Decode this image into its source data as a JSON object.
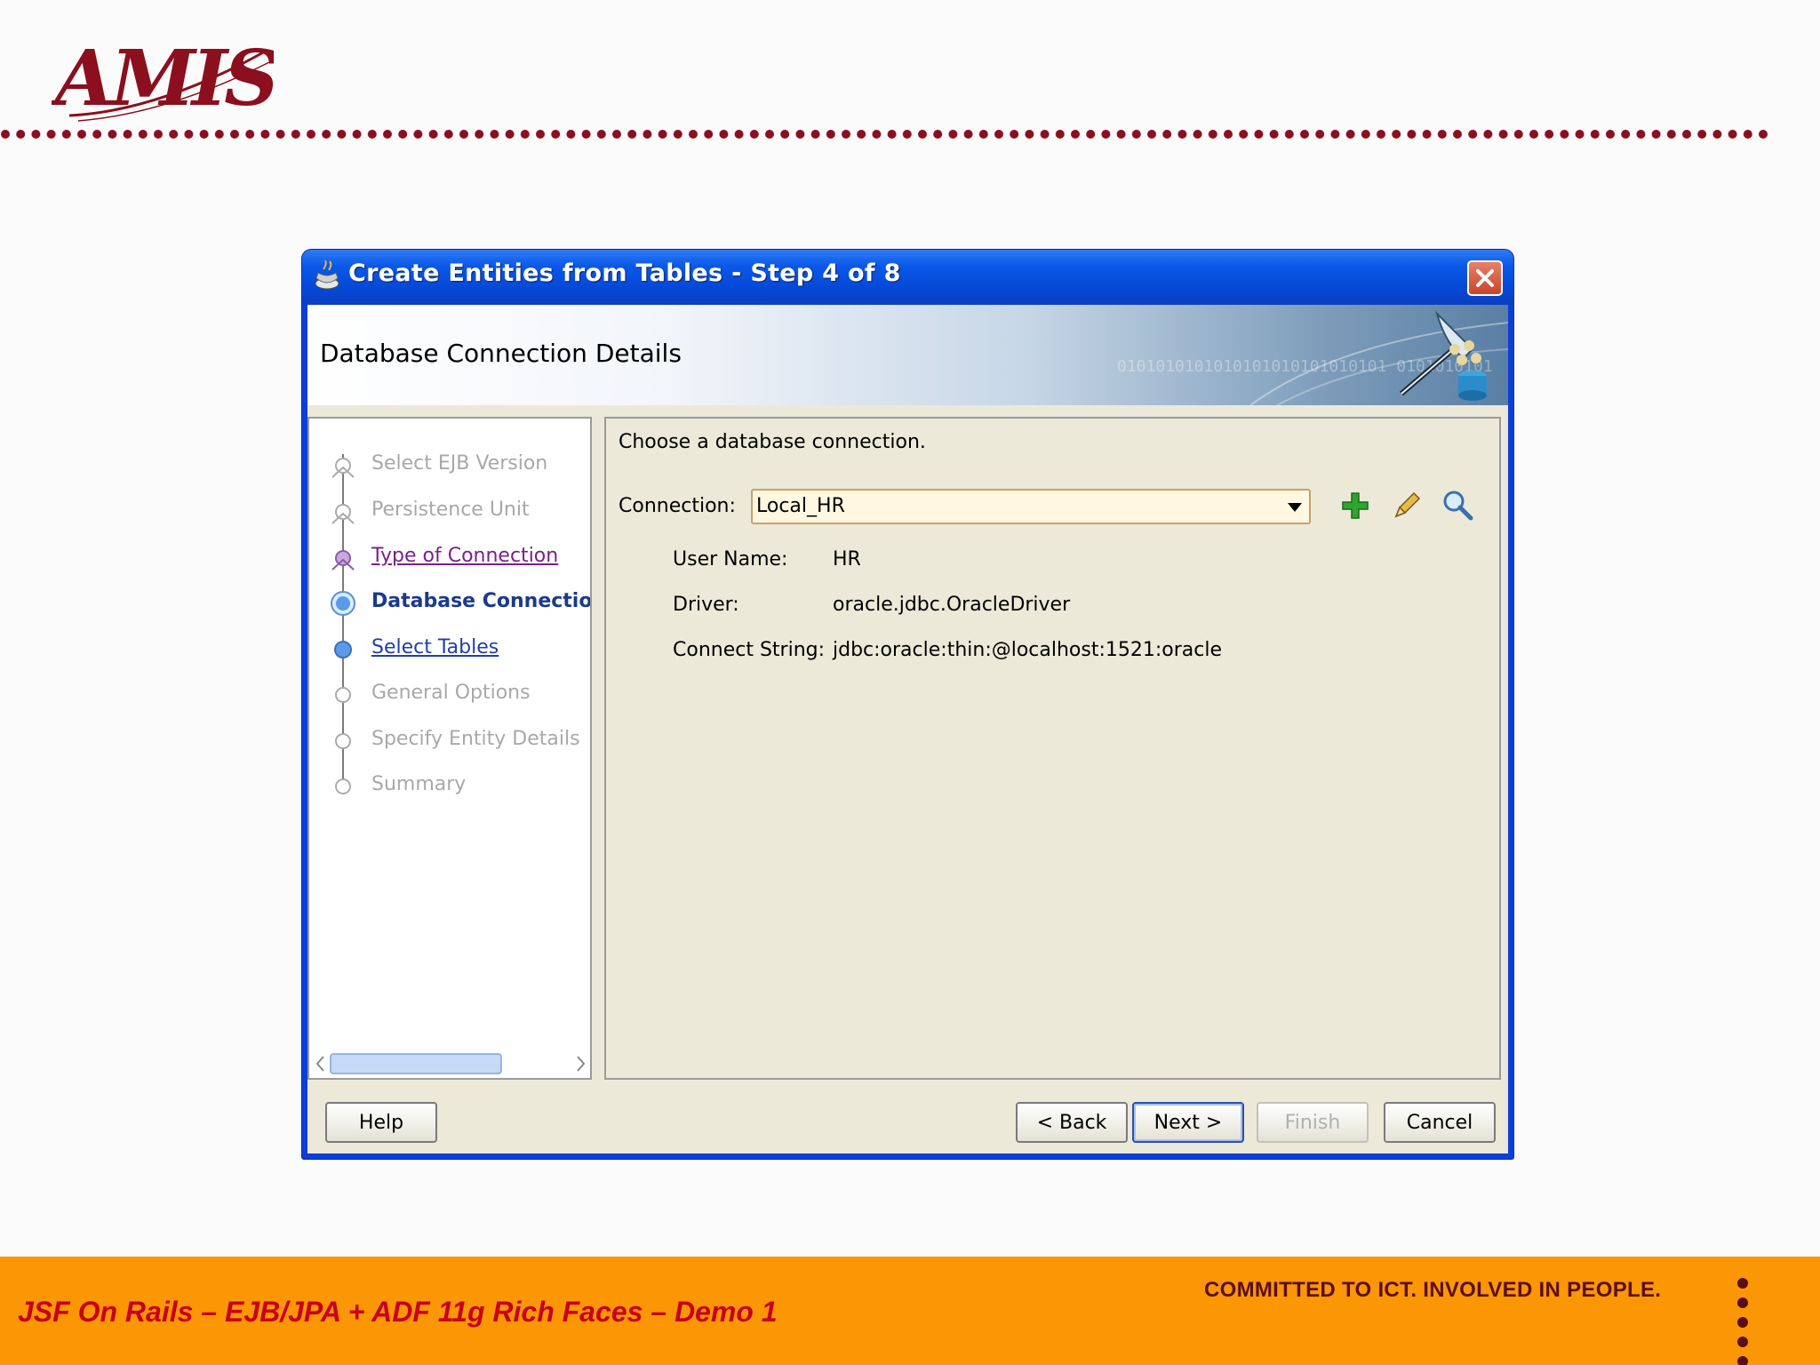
{
  "slide": {
    "logo_text": "AMIS",
    "footer_left": "JSF On Rails – EJB/JPA + ADF 11g Rich Faces – Demo 1",
    "footer_right": "COMMITTED TO ICT. INVOLVED IN PEOPLE.",
    "colors": {
      "brand": "#8b0f1e",
      "footer_bg": "#fb9604",
      "footer_text": "#c8001a"
    }
  },
  "dialog": {
    "title": "Create Entities from Tables - Step 4 of 8",
    "close_icon": "close-icon",
    "banner_title": "Database Connection Details",
    "banner_binary": "0101010101010101010101010101 0101010101",
    "nav": {
      "items": [
        {
          "label": "Select EJB Version",
          "state": "disabled"
        },
        {
          "label": "Persistence Unit",
          "state": "disabled"
        },
        {
          "label": "Type of Connection",
          "state": "visited"
        },
        {
          "label": "Database Connectio",
          "state": "current"
        },
        {
          "label": "Select Tables",
          "state": "link"
        },
        {
          "label": "General Options",
          "state": "disabled"
        },
        {
          "label": "Specify Entity Details",
          "state": "disabled"
        },
        {
          "label": "Summary",
          "state": "disabled"
        }
      ]
    },
    "content": {
      "instruction": "Choose a database connection.",
      "connection_label": "Connection:",
      "connection_value": "Local_HR",
      "icons": [
        "add-icon",
        "edit-icon",
        "search-icon"
      ],
      "details": [
        {
          "label": "User Name:",
          "value": "HR"
        },
        {
          "label": "Driver:",
          "value": "oracle.jdbc.OracleDriver"
        },
        {
          "label": "Connect String:",
          "value": "jdbc:oracle:thin:@localhost:1521:oracle"
        }
      ]
    },
    "buttons": {
      "help": "Help",
      "back": "< Back",
      "next": "Next >",
      "finish": "Finish",
      "cancel": "Cancel"
    }
  }
}
